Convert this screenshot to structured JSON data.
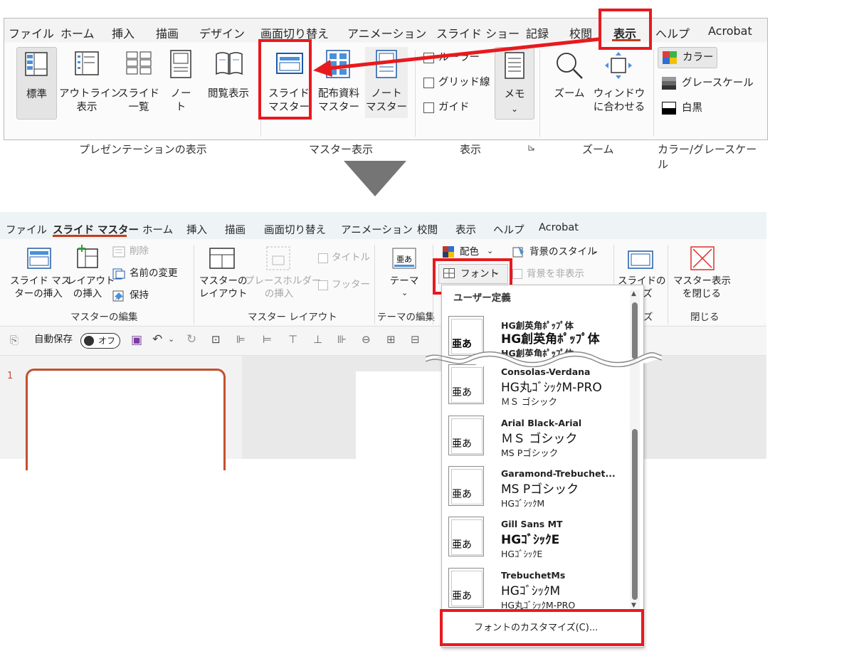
{
  "ribbon_view": {
    "tabs": [
      "ファイル",
      "ホーム",
      "挿入",
      "描画",
      "デザイン",
      "画面切り替え",
      "アニメーション",
      "スライド ショー",
      "記録",
      "校閲",
      "表示",
      "ヘルプ",
      "Acrobat"
    ],
    "active_tab": "表示",
    "groups": {
      "presentation_views": {
        "label": "プレゼンテーションの表示",
        "buttons": [
          "標準",
          "アウトライン\n表示",
          "スライド\n一覧",
          "ノー\nト",
          "閲覧表示"
        ]
      },
      "master_views": {
        "label": "マスター表示",
        "buttons": [
          "スライド\nマスター",
          "配布資料\nマスター",
          "ノート\nマスター"
        ]
      },
      "show": {
        "label": "表示",
        "checkboxes": [
          "ルーラー",
          "グリッド線",
          "ガイド"
        ],
        "memo": "メモ"
      },
      "zoom": {
        "label": "ズーム",
        "buttons": [
          "ズーム",
          "ウィンドウ\nに合わせる"
        ]
      },
      "color": {
        "label": "カラー/グレースケール",
        "options": [
          "カラー",
          "グレースケール",
          "白黒"
        ]
      }
    }
  },
  "ribbon_master": {
    "tabs": [
      "ファイル",
      "スライド マスター",
      "ホーム",
      "挿入",
      "描画",
      "画面切り替え",
      "アニメーション",
      "校閲",
      "表示",
      "ヘルプ",
      "Acrobat"
    ],
    "active_tab": "スライド マスター",
    "groups": {
      "edit_master": {
        "label": "マスターの編集",
        "buttons": [
          "スライド マス\nターの挿入",
          "レイアウト\nの挿入"
        ],
        "small": [
          "削除",
          "名前の変更",
          "保持"
        ]
      },
      "master_layout": {
        "label": "マスター レイアウト",
        "buttons": [
          "マスターの\nレイアウト",
          "プレースホルダー\nの挿入"
        ],
        "checks": [
          "タイトル",
          "フッター"
        ]
      },
      "edit_theme": {
        "label": "テーマの編集",
        "theme": "テーマ"
      },
      "background": {
        "colors": "配色",
        "fonts": "フォント",
        "bg_style": "背景のスタイル",
        "hide_bg": "背景を非表示"
      },
      "size": {
        "label_part": "ズ",
        "button_part": "スライドの",
        "button_tail": "ズ"
      },
      "close": {
        "label": "閉じる",
        "button": "マスター表示\nを閉じる"
      }
    }
  },
  "qat": {
    "autosave_label": "自動保存",
    "autosave_state": "オフ"
  },
  "slide_pane": {
    "slide_number": "1"
  },
  "font_dropdown": {
    "header": "ユーザー定義",
    "thumb_glyph": "亜あ",
    "items": [
      {
        "name": "HG創英角ﾎﾟｯﾌﾟ体",
        "heading": "HG創英角ﾎﾟｯﾌﾟ体",
        "body": "HG創英角ﾎﾟｯﾌﾟ体"
      },
      {
        "name": "Consolas-Verdana",
        "heading": "HG丸ｺﾞｼｯｸM-PRO",
        "body": "ＭＳ ゴシック"
      },
      {
        "name": "Arial Black-Arial",
        "heading": "ＭＳ ゴシック",
        "body": "MS Pゴシック"
      },
      {
        "name": "Garamond-Trebuchet...",
        "heading": "MS Pゴシック",
        "body": "HGｺﾞｼｯｸM"
      },
      {
        "name": "Gill Sans MT",
        "heading": "HGｺﾞｼｯｸE",
        "body": "HGｺﾞｼｯｸE"
      },
      {
        "name": "TrebuchetMs",
        "heading": "HGｺﾞｼｯｸM",
        "body": "HG丸ｺﾞｼｯｸM-PRO"
      }
    ],
    "customize": "フォントのカスタマイズ(C)..."
  },
  "colors": {
    "highlight": "#e8191e",
    "active_tab_underline": "#c43e1c",
    "arrow": "#757575"
  }
}
